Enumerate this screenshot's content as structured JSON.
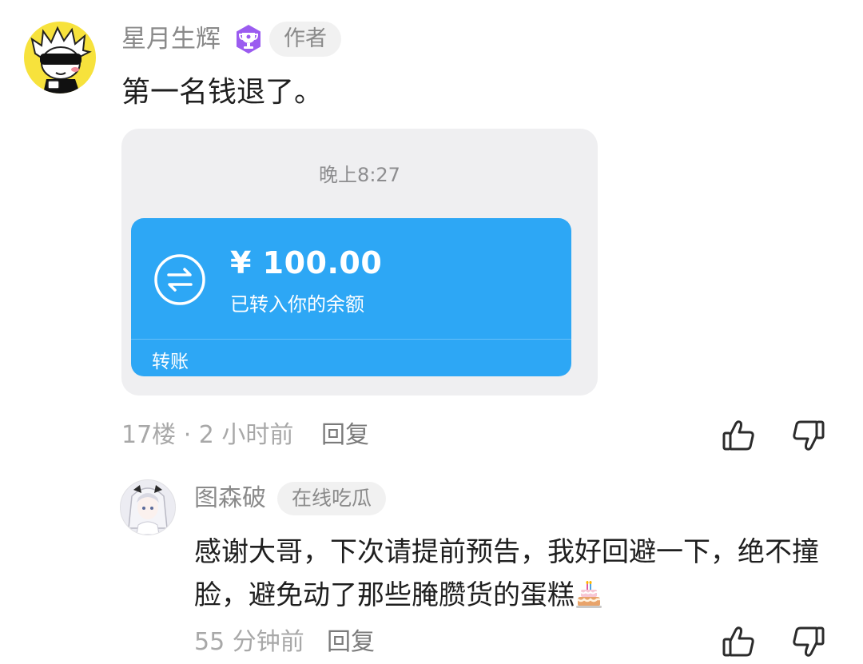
{
  "comment": {
    "username": "星月生辉",
    "author_tag": "作者",
    "text": "第一名钱退了。",
    "meta": "17楼 · 2 小时前",
    "reply_label": "回复",
    "badge_icon": "trophy-badge-icon",
    "badge_color": "#9b5cf0"
  },
  "screenshot": {
    "time": "晚上8:27",
    "amount": "¥ 100.00",
    "status": "已转入你的余额",
    "type_label": "转账",
    "accent_color": "#2da7f5",
    "icon": "transfer-arrows-icon"
  },
  "sub_reply": {
    "username": "图森破",
    "tag": "在线吃瓜",
    "text": "感谢大哥，下次请提前预告，我好回避一下，绝不撞脸，避免动了那些腌臜货的蛋糕",
    "emoji_icon": "birthday-cake-icon",
    "meta": "55 分钟前",
    "reply_label": "回复"
  },
  "actions": {
    "like_icon": "thumbs-up-icon",
    "dislike_icon": "thumbs-down-icon"
  }
}
